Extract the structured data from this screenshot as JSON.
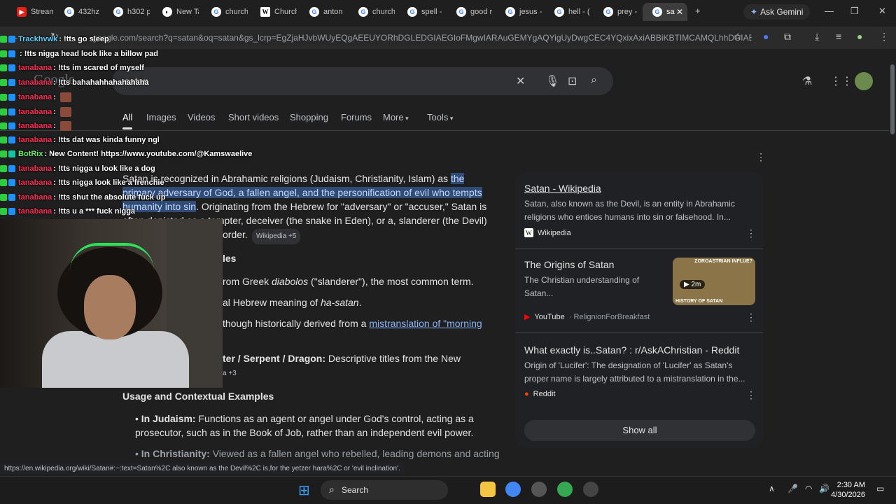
{
  "browser": {
    "tabs": [
      {
        "label": "Stream",
        "icon": "youtube-icon"
      },
      {
        "label": "432hz",
        "icon": "google-icon"
      },
      {
        "label": "h302 p",
        "icon": "google-icon"
      },
      {
        "label": "New Ta",
        "icon": "tab-icon"
      },
      {
        "label": "church",
        "icon": "google-icon"
      },
      {
        "label": "Church",
        "icon": "wikipedia-icon"
      },
      {
        "label": "anton",
        "icon": "google-icon"
      },
      {
        "label": "church",
        "icon": "google-icon"
      },
      {
        "label": "spell -",
        "icon": "google-icon"
      },
      {
        "label": "good r",
        "icon": "google-icon"
      },
      {
        "label": "jesus -",
        "icon": "google-icon"
      },
      {
        "label": "hell - (",
        "icon": "google-icon"
      },
      {
        "label": "prey -",
        "icon": "google-icon"
      },
      {
        "label": "sa",
        "icon": "google-icon"
      }
    ],
    "gemini_label": "Ask Gemini",
    "url": "google.com/search?q=satan&oq=satan&gs_lcrp=EgZjaHJvbWUyEQgAEEUYORhDGLEDGIAEGIoFMgwIARAuGEMYgAQYigUyDwgCEC4YQxixAxiABBiKBTIMCAMQLhhDGIAEGIoF...",
    "status_url": "https://en.wikipedia.org/wiki/Satan#:~:text=Satan%2C also known as the Devil%2C is,for the yetzer hara%2C or 'evil inclination'."
  },
  "google": {
    "logo": "Google",
    "query": "satan",
    "nav": [
      "All",
      "Images",
      "Videos",
      "Short videos",
      "Shopping",
      "Forums",
      "More",
      "Tools"
    ],
    "intro_plain": "Satan is recognized in Abrahamic religions (Judaism, Christianity, Islam) as ",
    "intro_hl1": "the",
    "intro_hl2": "primary adversary of God, a fallen angel, and the personification of evil who tempts",
    "intro_hl3": "humanity into sin",
    "intro_rest": ". Originating from the Hebrew for \"adversary\" or \"accuser,\" Satan is",
    "intro_line4": "often depicted as a tempter, deceiver (the snake in Eden), or a, slanderer (the Devil)",
    "intro_line5": "order.",
    "cite1": "Wikipedia +5",
    "section1": "les",
    "b1_pre": "rom Greek ",
    "b1_it": "diabolos",
    "b1_post": " (\"slanderer\"), the most common term.",
    "b2_pre": "al Hebrew meaning of ",
    "b2_it": "ha-satan",
    "b2_post": ".",
    "b3_pre": " though historically derived from a ",
    "b3_link": "mistranslation of \"morning",
    "b4_bold": "ter / Serpent / Dragon:",
    "b4_post": " Descriptive titles from the New",
    "cite2": "a +3",
    "section2": "Usage and Contextual Examples",
    "ex1_bold": "In Judaism:",
    "ex1_text": " Functions as an agent or angel under God's control, acting as a",
    "ex1_line2": "prosecutor, such as in the Book of Job, rather than an independent evil power.",
    "ex2_bold": "In Christianity:",
    "ex2_text": " Viewed as a fallen angel who rebelled, leading demons and acting",
    "panel": [
      {
        "title": "Satan - Wikipedia",
        "snippet": "Satan, also known as the Devil, is an entity in Abrahamic religions who entices humans into sin or falsehood. In...",
        "source": "Wikipedia",
        "sub": ""
      },
      {
        "title": "The Origins of Satan",
        "snippet": "The Christian understanding of Satan...",
        "source": "YouTube",
        "sub": "RelignionForBreakfast",
        "duration": "2m",
        "thumb_top": "ZOROASTRIAN INFLUE?",
        "thumb_bottom": "HISTORY OF SATAN"
      },
      {
        "title": "What exactly is..Satan? : r/AskAChristian - Reddit",
        "snippet": "Origin of 'Lucifer': The designation of 'Lucifer' as Satan's proper name is largely attributed to a mistranslation in the...",
        "source": "Reddit",
        "sub": ""
      }
    ],
    "show_all": "Show all"
  },
  "chat": [
    {
      "user": "Trackhvwk",
      "msg": ": !tts go sleep",
      "color": "#5ad1ff"
    },
    {
      "user": "",
      "msg": ": !tts nigga head look like a billow pad",
      "color": "#ff2d55"
    },
    {
      "user": "tanabana",
      "msg": ": !tts im scared of myself",
      "color": "#ff2d55"
    },
    {
      "user": "tanabana",
      "msg": ": !tts bahahahhahahahaha",
      "color": "#ff2d55"
    },
    {
      "user": "tanabana",
      "msg": ":",
      "color": "#ff2d55"
    },
    {
      "user": "tanabana",
      "msg": ":",
      "color": "#ff2d55"
    },
    {
      "user": "tanabana",
      "msg": ":",
      "color": "#ff2d55"
    },
    {
      "user": "tanabana",
      "msg": ": !tts dat was kinda funny ngl",
      "color": "#ff2d55"
    },
    {
      "user": "BotRix",
      "msg": ": New Content! https://www.youtube.com/@Kamswaelive",
      "color": "#6cf06c"
    },
    {
      "user": "tanabana",
      "msg": ": !tts nigga u look like a dog",
      "color": "#ff2d55"
    },
    {
      "user": "tanabana",
      "msg": ": !tts nigga look like a frenchie",
      "color": "#ff2d55"
    },
    {
      "user": "tanabana",
      "msg": ": !tts shut the absolute fuck up",
      "color": "#ff2d55"
    },
    {
      "user": "tanabana",
      "msg": ": !tts u a *** fuck nigga",
      "color": "#ff2d55"
    }
  ],
  "taskbar": {
    "search": "Search",
    "time": "2:30 AM",
    "date": "4/30/2026"
  }
}
